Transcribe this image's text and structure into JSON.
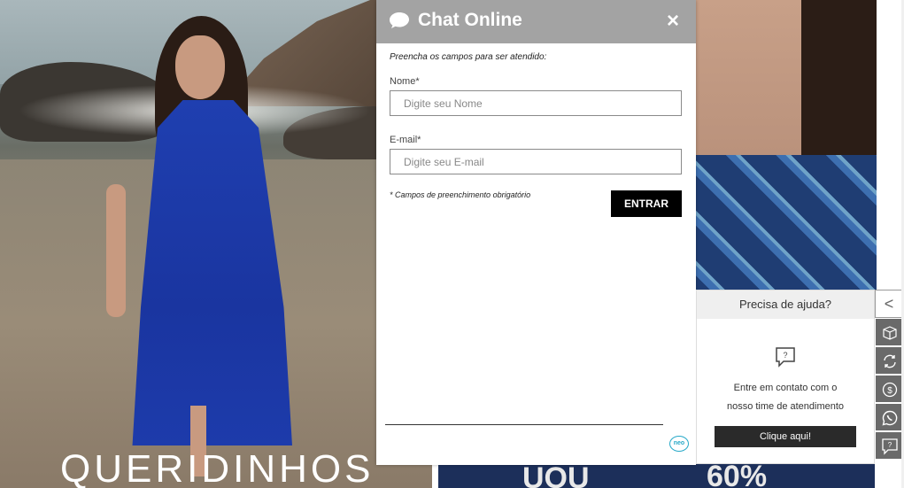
{
  "hero": {
    "caption": "QUERIDINHOS"
  },
  "chat": {
    "title": "Chat Online",
    "close_label": "×",
    "instructions": "Preencha os campos para ser atendido:",
    "name_label": "Nome*",
    "name_placeholder": "Digite seu Nome",
    "email_label": "E-mail*",
    "email_placeholder": "Digite seu E-mail",
    "required_note": "* Campos de preenchimento obrigatório",
    "enter_label": "ENTRAR",
    "logo_text": "neo"
  },
  "help": {
    "title": "Precisa de ajuda?",
    "line1": "Entre em contato com o",
    "line2": "nosso time de atendimento",
    "button_label": "Clique aqui!"
  },
  "sidebar": {
    "toggle_label": "<",
    "icons": [
      "box-icon",
      "exchange-icon",
      "money-icon",
      "whatsapp-icon",
      "help-chat-icon"
    ]
  },
  "banner": {
    "left_text": "UOU",
    "right_text": "60%"
  }
}
